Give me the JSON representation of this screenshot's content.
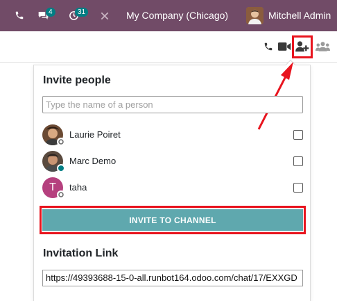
{
  "topbar": {
    "chat_badge": "4",
    "activity_badge": "31",
    "company": "My Company (Chicago)",
    "user_name": "Mitchell Admin"
  },
  "invite": {
    "title": "Invite people",
    "search_placeholder": "Type the name of a person",
    "people": [
      {
        "name": "Laurie Poiret",
        "status": "offline"
      },
      {
        "name": "Marc Demo",
        "status": "online"
      },
      {
        "name": "taha",
        "status": "offline",
        "initial": "T"
      }
    ],
    "button_label": "INVITE TO CHANNEL",
    "link_title": "Invitation Link",
    "link_value": "https://49393688-15-0-all.runbot164.odoo.com/chat/17/EXXGD"
  },
  "colors": {
    "topbar": "#714b67",
    "badge": "#017e84",
    "button": "#5fa8ae",
    "highlight": "#e8141e",
    "taha_avatar": "#b5407e"
  },
  "icons": [
    "phone-icon",
    "chat-icon",
    "activity-icon",
    "tools-icon",
    "video-icon",
    "add-user-icon",
    "members-icon"
  ]
}
